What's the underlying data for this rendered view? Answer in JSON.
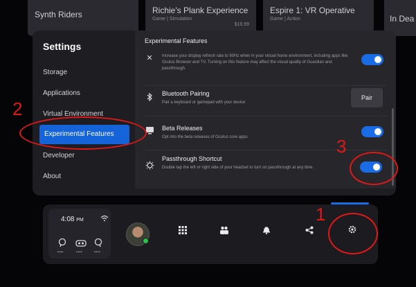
{
  "background_cards": [
    {
      "title": "Synth Riders",
      "subtitle": "",
      "extra": ""
    },
    {
      "title": "Richie's Plank Experience",
      "subtitle": "Game | Simulation",
      "extra": "$19.99"
    },
    {
      "title": "Espire 1: VR Operative",
      "subtitle": "Game | Action",
      "extra": ""
    },
    {
      "title": "In Dea",
      "subtitle": "",
      "extra": ""
    }
  ],
  "sidebar": {
    "title": "Settings",
    "items": [
      {
        "label": "Storage"
      },
      {
        "label": "Applications"
      },
      {
        "label": "Virtual Environment"
      },
      {
        "label": "Experimental Features"
      },
      {
        "label": "Developer"
      },
      {
        "label": "About"
      }
    ]
  },
  "content": {
    "title": "Experimental Features",
    "rows": [
      {
        "icon": "refresh-rate-icon",
        "title": "",
        "description": "Increase your display refresh rate to 90Hz when in your virtual home environment, including apps like Oculus Browser and TV. Turning on this feature may affect the visual quality of Guardian and passthrough.",
        "enabled": true
      },
      {
        "icon": "bluetooth-icon",
        "title": "Bluetooth Pairing",
        "description": "Pair a keyboard or gamepad with your device",
        "button": "Pair"
      },
      {
        "icon": "beta-icon",
        "title": "Beta Releases",
        "description": "Opt into the beta releases of Oculus core apps",
        "enabled": true
      },
      {
        "icon": "passthrough-icon",
        "title": "Passthrough Shortcut",
        "description": "Double tap the left or right side of your headset to turn on passthrough at any time.",
        "enabled": true
      }
    ]
  },
  "dock": {
    "time": "4:08",
    "ampm": "PM",
    "icons": [
      "wifi-icon",
      "controller-left-icon",
      "headset-icon",
      "controller-right-icon",
      "avatar",
      "apps-grid-icon",
      "people-icon",
      "notifications-bell-icon",
      "share-icon",
      "settings-gear-icon"
    ],
    "dots": "••••"
  },
  "annotations": [
    "1",
    "2",
    "3"
  ],
  "colors": {
    "accent": "#1a6be6",
    "annotation": "#e01818",
    "panel": "#1e1e22"
  }
}
